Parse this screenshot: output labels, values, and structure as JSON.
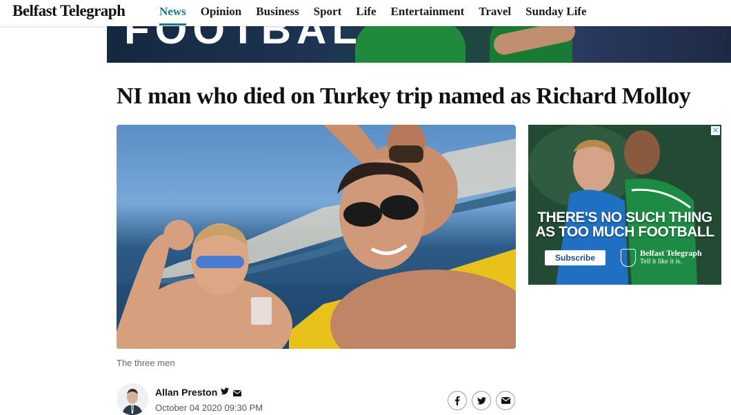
{
  "site": {
    "logo": "Belfast Telegraph"
  },
  "nav": {
    "items": [
      {
        "label": "News",
        "active": true
      },
      {
        "label": "Opinion"
      },
      {
        "label": "Business"
      },
      {
        "label": "Sport"
      },
      {
        "label": "Life"
      },
      {
        "label": "Entertainment"
      },
      {
        "label": "Travel"
      },
      {
        "label": "Sunday Life"
      }
    ],
    "active_color": "#167b8b"
  },
  "banner": {
    "text": "FOOTBALL"
  },
  "article": {
    "headline": "NI man who died on Turkey trip named as Richard Molloy",
    "caption": "The three men",
    "author": "Allan Preston",
    "date": "October 04 2020 09:30 PM"
  },
  "ad": {
    "headline_line1": "THERE'S NO SUCH THING",
    "headline_line2": "AS TOO MUCH FOOTBALL",
    "subscribe_label": "Subscribe",
    "brand": "Belfast Telegraph",
    "tagline": "Tell it like it is.",
    "close_glyph": "✕"
  },
  "share": {
    "icons": [
      "facebook-icon",
      "twitter-icon",
      "email-icon"
    ]
  }
}
